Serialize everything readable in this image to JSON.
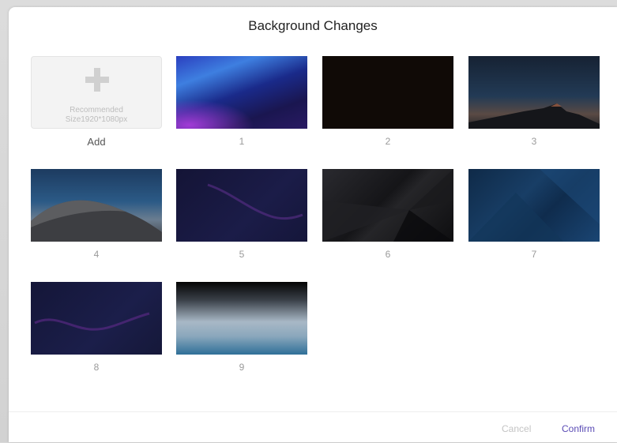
{
  "dialog": {
    "title": "Background Changes"
  },
  "add_tile": {
    "hint_line1": "Recommended",
    "hint_line2": "Size1920*1080px",
    "label": "Add"
  },
  "backgrounds": [
    {
      "label": "1"
    },
    {
      "label": "2"
    },
    {
      "label": "3"
    },
    {
      "label": "4"
    },
    {
      "label": "5"
    },
    {
      "label": "6"
    },
    {
      "label": "7"
    },
    {
      "label": "8"
    },
    {
      "label": "9"
    }
  ],
  "footer": {
    "cancel_label": "Cancel",
    "confirm_label": "Confirm"
  },
  "colors": {
    "confirm_accent": "#5a4bb5",
    "cancel_disabled": "#c4c4c4"
  }
}
